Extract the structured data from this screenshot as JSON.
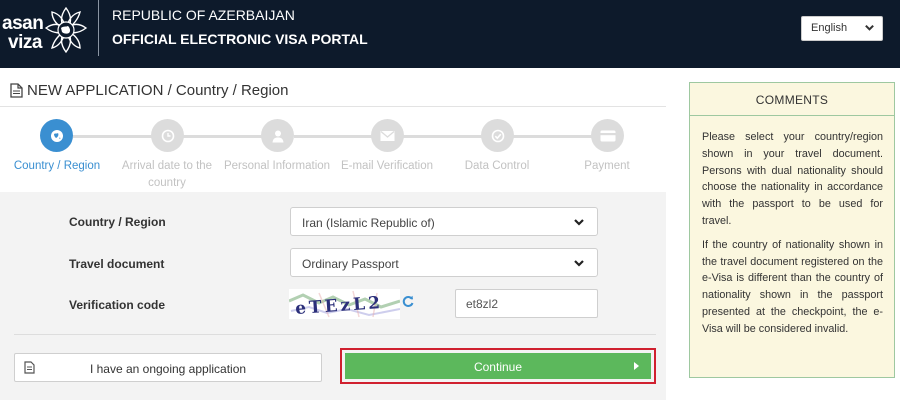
{
  "header": {
    "logo_line1": "asan",
    "logo_line2": "viza",
    "republic": "REPUBLIC OF AZERBAIJAN",
    "portal": "OFFICIAL ELECTRONIC VISA PORTAL",
    "language": "English"
  },
  "page": {
    "title": "NEW APPLICATION / Country / Region"
  },
  "steps": [
    {
      "label": "Country / Region",
      "icon": "globe-icon",
      "active": true
    },
    {
      "label": "Arrival date to the country",
      "icon": "clock-icon",
      "active": false
    },
    {
      "label": "Personal Information",
      "icon": "person-icon",
      "active": false
    },
    {
      "label": "E-mail Verification",
      "icon": "envelope-icon",
      "active": false
    },
    {
      "label": "Data Control",
      "icon": "check-icon",
      "active": false
    },
    {
      "label": "Payment",
      "icon": "credit-card-icon",
      "active": false
    }
  ],
  "form": {
    "country_label": "Country / Region",
    "country_value": "Iran (Islamic Republic of)",
    "document_label": "Travel document",
    "document_value": "Ordinary Passport",
    "verification_label": "Verification code",
    "captcha_text": "eTEzL2",
    "code_value": "et8zl2"
  },
  "buttons": {
    "ongoing": "I have an ongoing application",
    "continue": "Continue"
  },
  "comments": {
    "title": "COMMENTS",
    "paragraph1": "Please select your country/region shown in your travel document. Persons with dual nationality should choose the nationality in accordance with the passport to be used for travel.",
    "paragraph2": "If the country of nationality shown in the travel document registered on the e-Visa is different than the country of nationality shown in the passport presented at the checkpoint, the e-Visa will be considered invalid."
  },
  "colors": {
    "header_bg": "#0d1a2b",
    "active_step": "#3a8fd1",
    "continue_green": "#5cb85c",
    "highlight_red": "#d0202f",
    "comments_bg": "#fbf7df"
  }
}
